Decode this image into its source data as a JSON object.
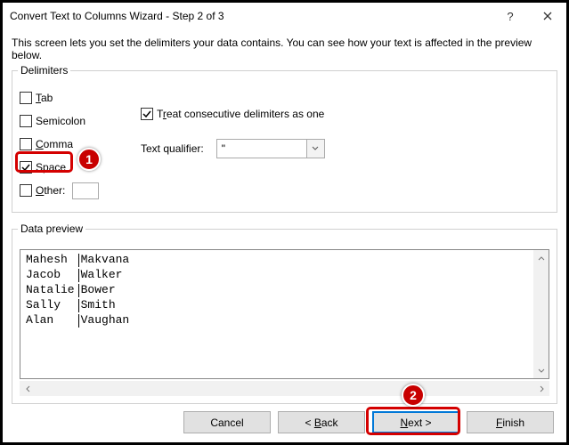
{
  "titlebar": {
    "title": "Convert Text to Columns Wizard - Step 2 of 3",
    "help": "?",
    "close": "✕"
  },
  "description": "This screen lets you set the delimiters your data contains. You can see how your text is affected in the preview below.",
  "delimiters": {
    "legend": "Delimiters",
    "tab": {
      "label": "Tab",
      "mnemonic": "T",
      "checked": false
    },
    "semicolon": {
      "label": "Semicolon",
      "mnemonic": "",
      "checked": false
    },
    "comma": {
      "label": "Comma",
      "mnemonic": "C",
      "checked": false
    },
    "space": {
      "label": "Space",
      "mnemonic": "S",
      "checked": true
    },
    "other": {
      "label": "Other:",
      "mnemonic": "O",
      "checked": false,
      "value": ""
    }
  },
  "treat_consecutive": {
    "label": "Treat consecutive delimiters as one",
    "mnemonic": "T",
    "checked": true
  },
  "text_qualifier": {
    "label": "Text qualifier:",
    "mnemonic": "q",
    "value": "\""
  },
  "preview": {
    "legend": "Data preview",
    "rows": [
      {
        "c0": "Mahesh ",
        "c1": "Makvana"
      },
      {
        "c0": "Jacob  ",
        "c1": "Walker"
      },
      {
        "c0": "Natalie",
        "c1": "Bower"
      },
      {
        "c0": "Sally  ",
        "c1": "Smith"
      },
      {
        "c0": "Alan   ",
        "c1": "Vaughan"
      }
    ]
  },
  "buttons": {
    "cancel": "Cancel",
    "back": "< Back",
    "next": "Next >",
    "finish": "Finish"
  },
  "callouts": {
    "one": "1",
    "two": "2"
  }
}
